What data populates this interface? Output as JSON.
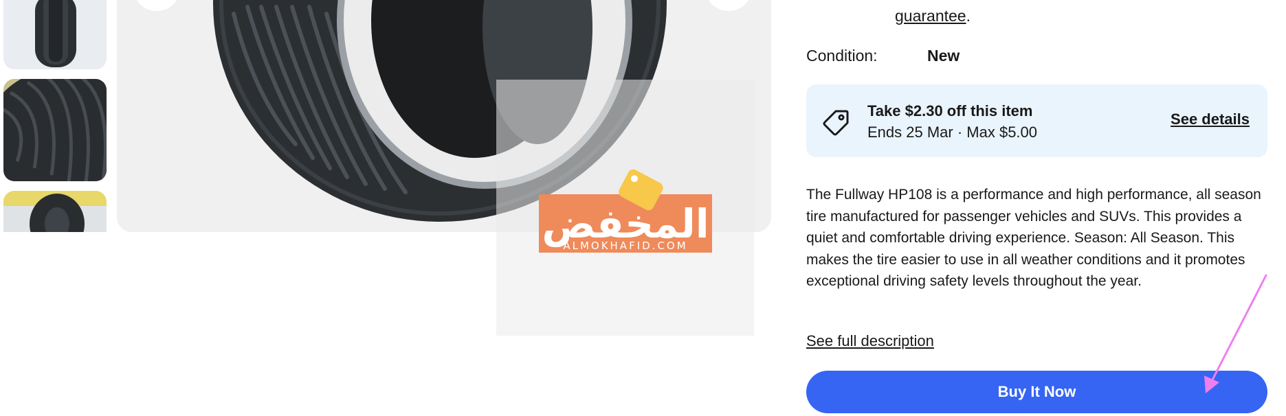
{
  "watermark": {
    "arabic_text": "المخفض",
    "site_text": "ALMOKHAFID.COM"
  },
  "product": {
    "guarantee_link": "guarantee",
    "guarantee_suffix": ".",
    "condition_label": "Condition:",
    "condition_value": "New"
  },
  "promo": {
    "title": "Take $2.30 off this item",
    "subtitle": "Ends 25 Mar · Max $5.00",
    "link_label": "See details"
  },
  "description": {
    "text": "The Fullway HP108 is a performance and high performance, all season tire manufactured for passenger vehicles and SUVs. This provides a quiet and comfortable driving experience. Season: All Season. This makes the tire easier to use in all weather conditions and it promotes exceptional driving safety levels throughout the year.",
    "full_link": "See full description"
  },
  "actions": {
    "buy_now": "Buy It Now"
  },
  "colors": {
    "accent": "#3665f3",
    "promo_bg": "#eaf4fd",
    "annotation_arrow": "#f07ef0",
    "watermark_orange": "#ef8a5a"
  }
}
